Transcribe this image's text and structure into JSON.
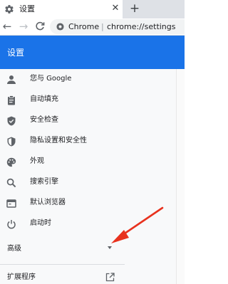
{
  "tab": {
    "title": "设置",
    "close_glyph": "✕",
    "icon": "gear-icon"
  },
  "new_tab_glyph": "+",
  "toolbar": {
    "back_glyph": "←",
    "forward_glyph": "→",
    "reload_glyph": "C",
    "omnibox": {
      "site_label": "Chrome",
      "separator": "|",
      "url": "chrome://settings"
    }
  },
  "header": {
    "title": "设置",
    "color": "#1a73e8"
  },
  "sidebar": {
    "items": [
      {
        "label": "您与 Google",
        "icon": "person-icon"
      },
      {
        "label": "自动填充",
        "icon": "clipboard-icon"
      },
      {
        "label": "安全检查",
        "icon": "shield-check-icon"
      },
      {
        "label": "隐私设置和安全性",
        "icon": "shield-half-icon"
      },
      {
        "label": "外观",
        "icon": "palette-icon"
      },
      {
        "label": "搜索引擎",
        "icon": "search-icon"
      },
      {
        "label": "默认浏览器",
        "icon": "browser-icon"
      },
      {
        "label": "启动时",
        "icon": "power-icon"
      }
    ],
    "advanced": {
      "label": "高级",
      "icon": "caret-down-icon"
    },
    "extensions": {
      "label": "扩展程序",
      "icon": "open-external-icon"
    }
  },
  "annotation": {
    "color": "#e8321e",
    "icon": "red-arrow"
  }
}
